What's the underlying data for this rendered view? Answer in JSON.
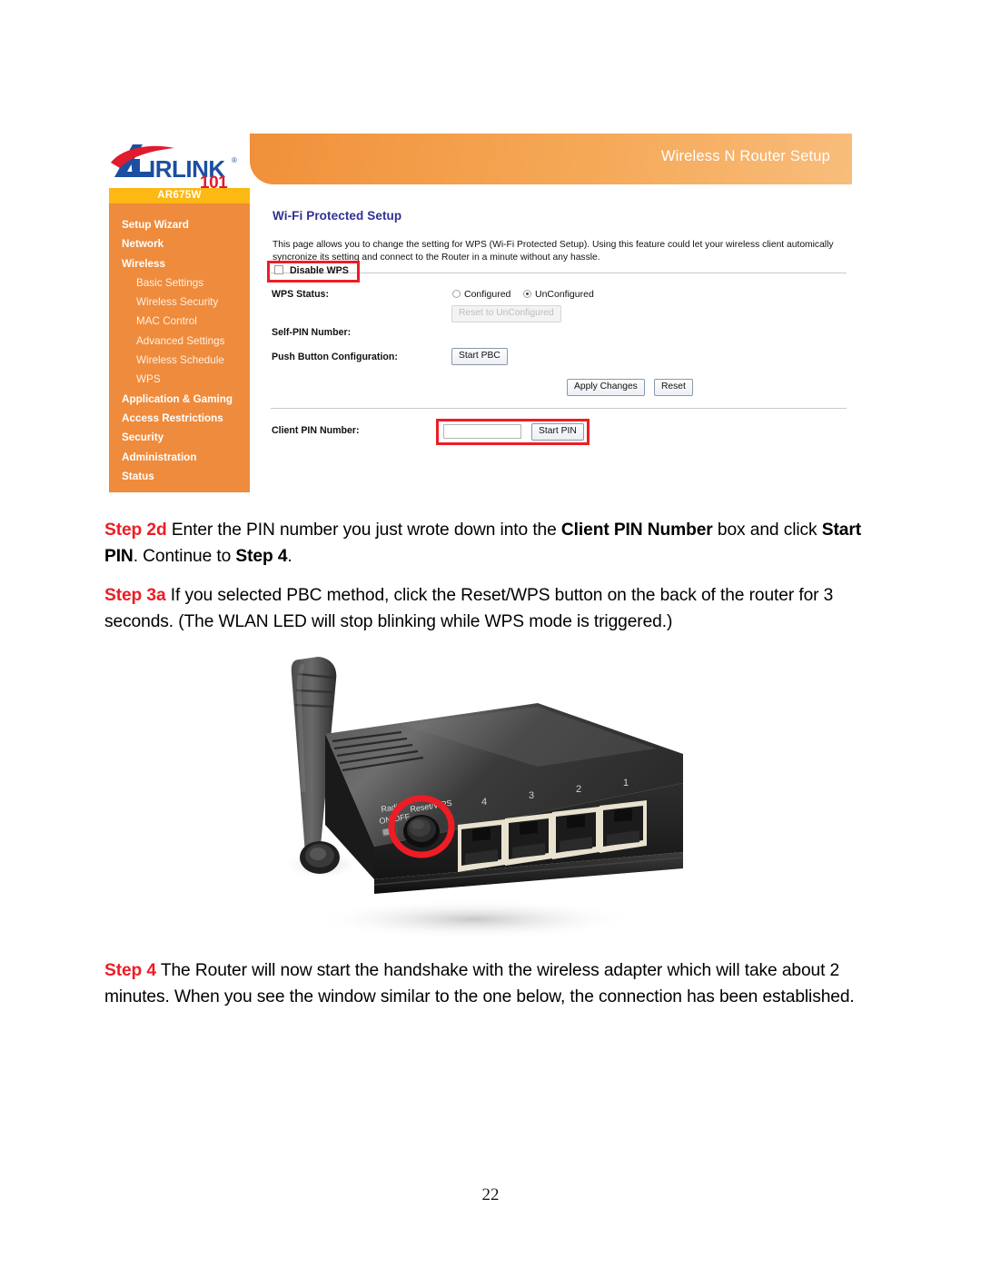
{
  "document": {
    "page_number": "22"
  },
  "router_ui": {
    "banner_title": "Wireless N Router Setup",
    "logo": {
      "brand": "AIRLINK",
      "sub": "101",
      "registered_mark": "®"
    },
    "sidebar": {
      "model": "AR675W",
      "items": [
        {
          "label": "Setup Wizard",
          "sub": false
        },
        {
          "label": "Network",
          "sub": false
        },
        {
          "label": "Wireless",
          "sub": false
        },
        {
          "label": "Basic Settings",
          "sub": true
        },
        {
          "label": "Wireless Security",
          "sub": true
        },
        {
          "label": "MAC Control",
          "sub": true
        },
        {
          "label": "Advanced Settings",
          "sub": true
        },
        {
          "label": "Wireless Schedule",
          "sub": true
        },
        {
          "label": "WPS",
          "sub": true
        },
        {
          "label": "Application & Gaming",
          "sub": false
        },
        {
          "label": "Access Restrictions",
          "sub": false
        },
        {
          "label": "Security",
          "sub": false
        },
        {
          "label": "Administration",
          "sub": false
        },
        {
          "label": "Status",
          "sub": false
        }
      ]
    },
    "content": {
      "title": "Wi-Fi Protected Setup",
      "description": "This page allows you to change the setting for WPS (Wi-Fi Protected Setup). Using this feature could let your wireless client automically syncronize its setting and connect to the Router in a minute without any hassle.",
      "disable_wps_label": "Disable WPS",
      "disable_wps_checked": false,
      "wps_status_label": "WPS Status:",
      "wps_status_options": [
        "Configured",
        "UnConfigured"
      ],
      "wps_status_selected": "UnConfigured",
      "reset_unconfigured_button": "Reset to UnConfigured",
      "reset_unconfigured_disabled": true,
      "self_pin_label": "Self-PIN Number:",
      "self_pin_value": "",
      "push_button_label": "Push Button Configuration:",
      "start_pbc_button": "Start PBC",
      "apply_changes_button": "Apply Changes",
      "reset_button": "Reset",
      "client_pin_label": "Client PIN Number:",
      "client_pin_value": "",
      "start_pin_button": "Start PIN"
    },
    "colors": {
      "sidebar_orange": "#ef8b3c",
      "model_bar_yellow": "#fcb813",
      "banner_orange": "#f5a856",
      "title_blue": "#2e3192",
      "highlight_red": "#ee1c25"
    }
  },
  "steps": [
    {
      "id": "step-2d",
      "label": "Step 2d",
      "parts": [
        {
          "text": " Enter the PIN number you just wrote down into the ",
          "bold": false
        },
        {
          "text": "Client PIN Number",
          "bold": true
        },
        {
          "text": " box and click ",
          "bold": false
        },
        {
          "text": "Start PIN",
          "bold": true
        },
        {
          "text": ".  Continue to ",
          "bold": false
        },
        {
          "text": "Step 4",
          "bold": true
        },
        {
          "text": ".",
          "bold": false
        }
      ]
    },
    {
      "id": "step-3a",
      "label": "Step 3a",
      "parts": [
        {
          "text": " If you selected PBC method, click the Reset/WPS button on the back of the router for 3 seconds. (The WLAN LED will stop blinking while WPS mode is triggered.)",
          "bold": false
        }
      ]
    },
    {
      "id": "step-4",
      "label": "Step 4",
      "parts": [
        {
          "text": " The Router will now start the handshake with the wireless adapter which will take about 2 minutes. When you see the window similar to the one below, the connection has been established.",
          "bold": false
        }
      ]
    }
  ],
  "photo": {
    "caption_labels": {
      "radio_on_off": "Radio ON/OFF",
      "reset_wps": "Reset/WPS",
      "ports": [
        "4",
        "3",
        "2",
        "1"
      ]
    },
    "highlight_color": "#ee1c25"
  }
}
